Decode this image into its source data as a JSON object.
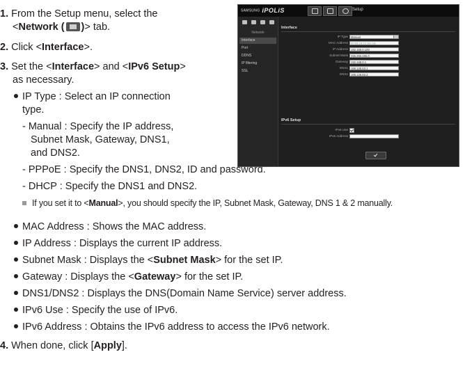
{
  "steps": {
    "s1": {
      "num": "1.",
      "a": "From the Setup menu, select the",
      "b_pre": "<",
      "b_bold": "Network (",
      "b_bold2": ")",
      "b_post": "> tab."
    },
    "s2": {
      "num": "2.",
      "pre": "Click <",
      "bold": "Interface",
      "post": ">."
    },
    "s3": {
      "num": "3.",
      "a_pre": "Set the <",
      "a_b1": "Interface",
      "a_mid": "> and <",
      "a_b2": "IPv6 Setup",
      "a_post": ">",
      "b": "as necessary."
    },
    "s4": {
      "num": "4.",
      "pre": "When done, click [",
      "bold": "Apply",
      "post": "]."
    }
  },
  "iptype": {
    "line1": "IP Type : Select an IP connection",
    "line2": "type.",
    "manual1": "- Manual : Specify the IP address,",
    "manual2": "Subnet Mask, Gateway, DNS1,",
    "manual3": "and DNS2.",
    "pppoe": "- PPPoE : Specify the DNS1, DNS2, ID and password.",
    "dhcp": "- DHCP : Specify the DNS1 and DNS2."
  },
  "note": {
    "pre": "If you set it to <",
    "bold": "Manual",
    "post": ">, you should specify the IP, Subnet Mask, Gateway, DNS 1 & 2 manually."
  },
  "bullets": [
    "MAC Address : Shows the MAC address.",
    "IP Address : Displays the current IP address."
  ],
  "b_subnet": {
    "pre": "Subnet Mask : Displays the <",
    "bold": "Subnet Mask",
    "post": "> for the set IP."
  },
  "b_gateway": {
    "pre": "Gateway : Displays the <",
    "bold": "Gateway",
    "post": "> for the set IP."
  },
  "bullets2": [
    "DNS1/DNS2 : Displays the DNS(Domain Name Service) server address.",
    "IPv6 Use : Specify the use of IPv6.",
    "IPv6 Address : Obtains the IPv6 address to access the IPv6 network."
  ],
  "screenshot": {
    "logo_small": "SAMSUNG",
    "logo_main": "iPOLiS",
    "tab_title": "Setup",
    "sidebar_heading": "Network",
    "sidebar_items": [
      "Interface",
      "Port",
      "DDNS",
      "IP filtering",
      "SSL"
    ],
    "section_interface": "Interface",
    "fields": [
      {
        "label": "IP Type",
        "value": "Manual"
      },
      {
        "label": "MAC Address",
        "value": "00:09:18:1C:BA:1B"
      },
      {
        "label": "IP Address",
        "value": "192.168.0.100"
      },
      {
        "label": "Subnet Mask",
        "value": "255.255.255.0"
      },
      {
        "label": "Gateway",
        "value": "192.168.0.1"
      },
      {
        "label": "DNS1",
        "value": "168.126.63.1"
      },
      {
        "label": "DNS2",
        "value": "168.126.63.2"
      }
    ],
    "section_ipv6": "IPv6 Setup",
    "ipv6_use_label": "IPv6 Use",
    "ipv6_addr_label": "IPv6 Address",
    "ipv6_addr_value": ""
  },
  "colors": {
    "text": "#231f20",
    "panel": "#1d1d1d",
    "field": "#f4f4f4"
  }
}
